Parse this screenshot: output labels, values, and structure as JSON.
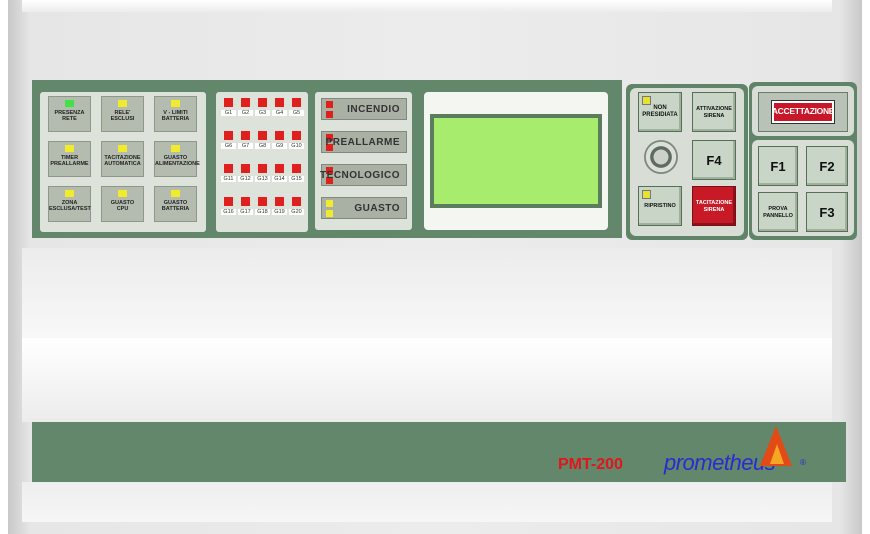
{
  "status_tiles": [
    {
      "label": "PRESENZA\nRETE",
      "led": "#43e04a"
    },
    {
      "label": "RELE'\nESCLUSI",
      "led": "#f2ea2c"
    },
    {
      "label": "V - LIMITI\nBATTERIA",
      "led": "#f2ea2c"
    },
    {
      "label": "TIMER\nPREALLARME",
      "led": "#f2ea2c"
    },
    {
      "label": "TACITAZIONE\nAUTOMATICA",
      "led": "#f2ea2c"
    },
    {
      "label": "GUASTO\nALIMENTAZIONE",
      "led": "#f2ea2c"
    },
    {
      "label": "ZONA\nESCLUSA/TEST",
      "led": "#f2ea2c"
    },
    {
      "label": "GUASTO\nCPU",
      "led": "#f2ea2c"
    },
    {
      "label": "GUASTO\nBATTERIA",
      "led": "#f2ea2c"
    }
  ],
  "zones": [
    "G1",
    "G2",
    "G3",
    "G4",
    "G5",
    "G6",
    "G7",
    "G8",
    "G9",
    "G10",
    "G11",
    "G12",
    "G13",
    "G14",
    "G15",
    "G16",
    "G17",
    "G18",
    "G19",
    "G20"
  ],
  "alarms": [
    {
      "label": "INCENDIO",
      "colors": [
        "#e0201c",
        "#e0201c"
      ]
    },
    {
      "label": "PREALLARME",
      "colors": [
        "#e0201c",
        "#e0201c"
      ]
    },
    {
      "label": "TECNOLOGICO",
      "colors": [
        "#e0201c",
        "#e0201c"
      ]
    },
    {
      "label": "GUASTO",
      "colors": [
        "#f2ea2c",
        "#f2ea2c"
      ]
    }
  ],
  "keys": {
    "non_presidiata": "NON\nPRESIDIATA",
    "attivazione_sirena": "ATTIVAZIONE\nSIRENA",
    "f4": "F4",
    "ripristino": "RIPRISTINO",
    "tacitazione_sirena": "TACITAZIONE\nSIRENA",
    "accettazione": "ACCETTAZIONE",
    "f1": "F1",
    "f2": "F2",
    "prova_pannello": "PROVA\nPANNELLO",
    "f3": "F3"
  },
  "brand": {
    "model": "PMT-200",
    "name": "prometheus"
  },
  "colors": {
    "panel_green": "#62876a",
    "lcd_green": "#a8ec6e",
    "alarm_red": "#e0201c",
    "led_yellow": "#f2ea2c"
  }
}
